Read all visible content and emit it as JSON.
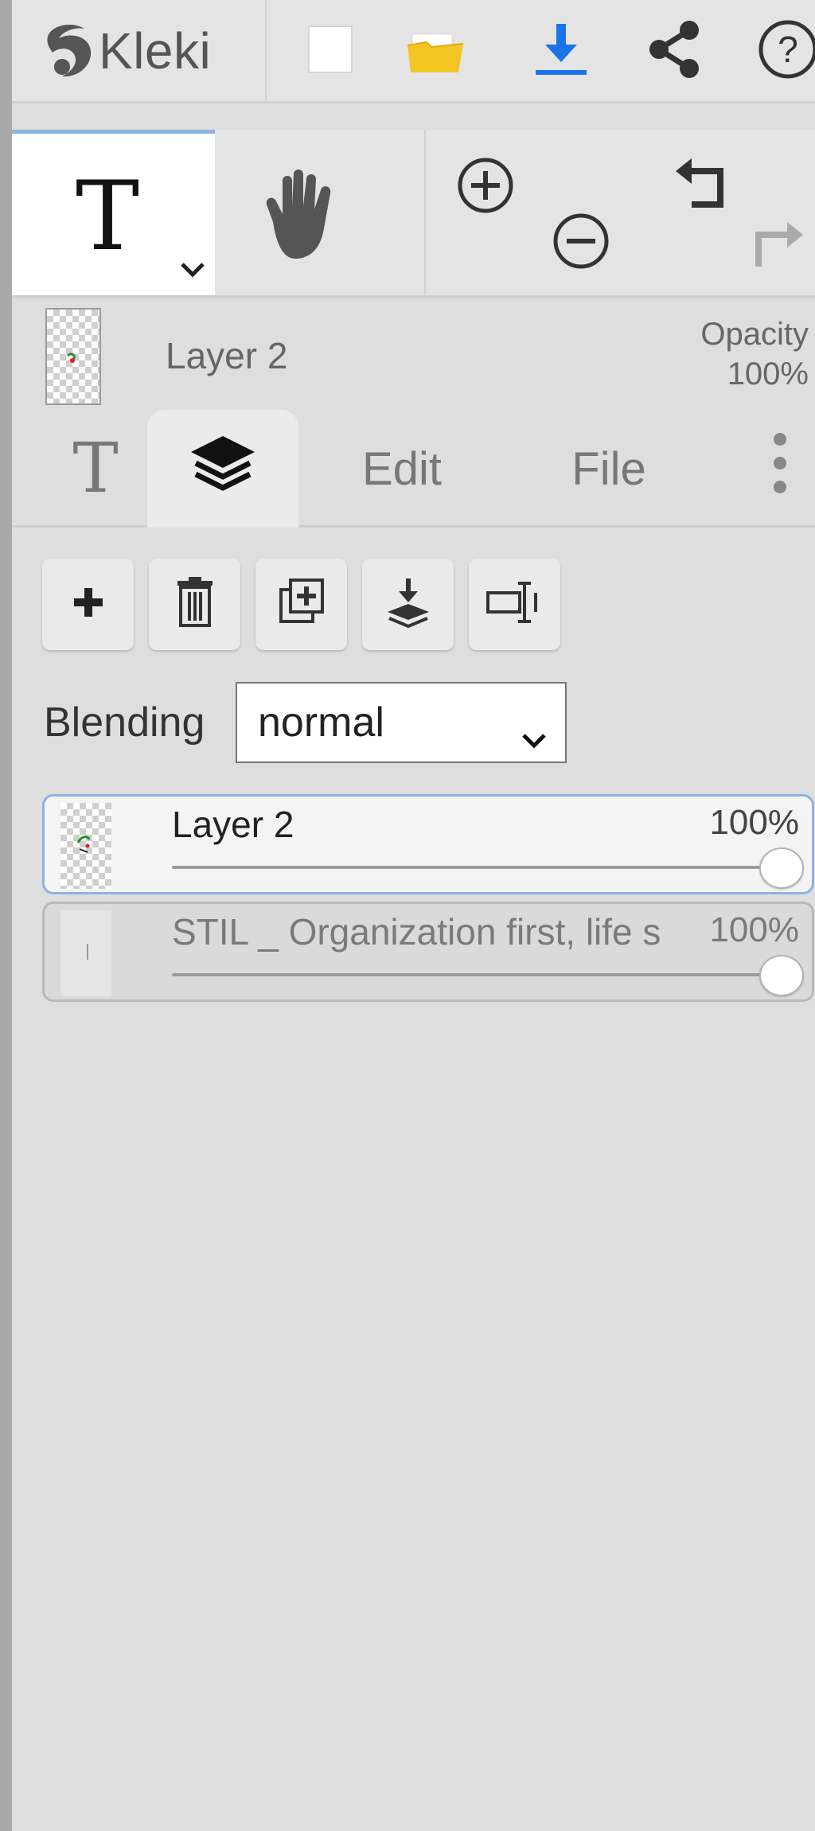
{
  "app": {
    "name": "Kleki"
  },
  "topbar": {
    "buttons": [
      {
        "icon": "new-image-icon"
      },
      {
        "icon": "open-folder-icon"
      },
      {
        "icon": "download-icon",
        "color": "#1a73e8"
      },
      {
        "icon": "share-icon"
      },
      {
        "icon": "help-icon"
      }
    ]
  },
  "tools": {
    "active_tool_glyph": "T",
    "active_tool_icon": "text-tool-icon",
    "hand_tool_icon": "hand-icon",
    "zoom_in_icon": "zoom-in-icon",
    "zoom_out_icon": "zoom-out-icon",
    "undo_icon": "undo-icon",
    "redo_icon": "redo-icon"
  },
  "current_layer": {
    "name": "Layer 2",
    "opacity_label": "Opacity",
    "opacity_value": "100%"
  },
  "tabs": [
    {
      "label": "T",
      "icon": "text-tab-icon"
    },
    {
      "label": "",
      "icon": "layers-icon",
      "active": true
    },
    {
      "label": "Edit"
    },
    {
      "label": "File"
    },
    {
      "label": "",
      "icon": "more-vertical-icon"
    }
  ],
  "layer_actions": [
    {
      "icon": "add-layer-icon"
    },
    {
      "icon": "delete-layer-icon"
    },
    {
      "icon": "duplicate-layer-icon"
    },
    {
      "icon": "merge-down-icon"
    },
    {
      "icon": "rename-layer-icon"
    }
  ],
  "blending": {
    "label": "Blending",
    "value": "normal"
  },
  "layers": [
    {
      "name": "Layer 2",
      "opacity": "100%",
      "opacity_fraction": 1.0,
      "selected": true
    },
    {
      "name": "STIL _ Organization first, life s",
      "opacity": "100%",
      "opacity_fraction": 1.0,
      "selected": false
    }
  ],
  "colors": {
    "accent_blue": "#8db3e2",
    "download_blue": "#1a73e8",
    "folder_yellow": "#f3c623"
  }
}
